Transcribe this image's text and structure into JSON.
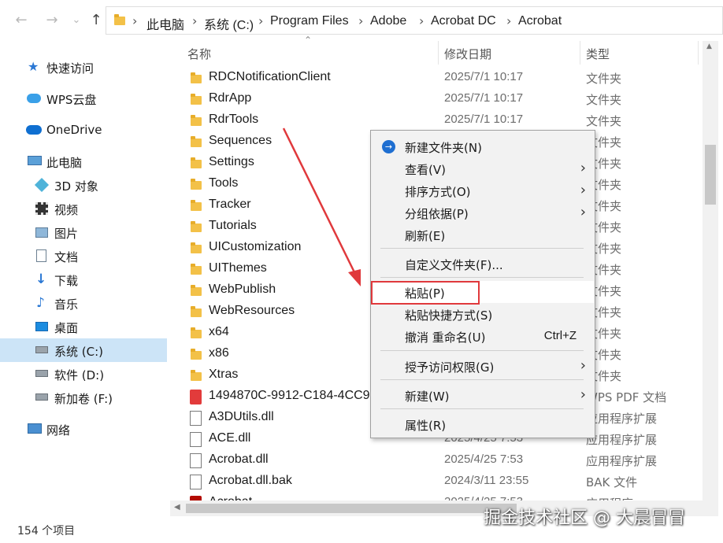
{
  "nav": {
    "back_icon": "back-arrow-icon",
    "forward_icon": "forward-arrow-icon",
    "up_icon": "up-arrow-icon",
    "breadcrumbs": [
      "此电脑",
      "系统 (C:)",
      "Program Files",
      "Adobe",
      "Acrobat DC",
      "Acrobat"
    ]
  },
  "sidebar": {
    "items": [
      {
        "label": "快速访问",
        "icon": "star-icon"
      },
      {
        "label": "WPS云盘",
        "icon": "cloud-icon"
      },
      {
        "label": "OneDrive",
        "icon": "onedrive-icon"
      },
      {
        "label": "此电脑",
        "icon": "computer-icon"
      },
      {
        "label": "3D 对象",
        "icon": "cube-icon"
      },
      {
        "label": "视频",
        "icon": "film-icon"
      },
      {
        "label": "图片",
        "icon": "picture-icon"
      },
      {
        "label": "文档",
        "icon": "document-icon"
      },
      {
        "label": "下载",
        "icon": "download-icon"
      },
      {
        "label": "音乐",
        "icon": "music-icon"
      },
      {
        "label": "桌面",
        "icon": "desktop-icon"
      },
      {
        "label": "系统 (C:)",
        "icon": "drive-icon",
        "selected": true
      },
      {
        "label": "软件 (D:)",
        "icon": "drive-icon"
      },
      {
        "label": "新加卷 (F:)",
        "icon": "drive-icon"
      },
      {
        "label": "网络",
        "icon": "network-icon"
      }
    ]
  },
  "columns": {
    "name": "名称",
    "date": "修改日期",
    "type": "类型"
  },
  "files": [
    {
      "name": "RDCNotificationClient",
      "date": "2025/7/1 10:17",
      "type": "文件夹",
      "kind": "folder"
    },
    {
      "name": "RdrApp",
      "date": "2025/7/1 10:17",
      "type": "文件夹",
      "kind": "folder"
    },
    {
      "name": "RdrTools",
      "date": "2025/7/1 10:17",
      "type": "文件夹",
      "kind": "folder"
    },
    {
      "name": "Sequences",
      "date": "",
      "type": "文件夹",
      "kind": "folder"
    },
    {
      "name": "Settings",
      "date": "",
      "type": "文件夹",
      "kind": "folder"
    },
    {
      "name": "Tools",
      "date": "",
      "type": "文件夹",
      "kind": "folder"
    },
    {
      "name": "Tracker",
      "date": "",
      "type": "文件夹",
      "kind": "folder"
    },
    {
      "name": "Tutorials",
      "date": "",
      "type": "文件夹",
      "kind": "folder"
    },
    {
      "name": "UICustomization",
      "date": "",
      "type": "文件夹",
      "kind": "folder"
    },
    {
      "name": "UIThemes",
      "date": "",
      "type": "文件夹",
      "kind": "folder"
    },
    {
      "name": "WebPublish",
      "date": "",
      "type": "文件夹",
      "kind": "folder"
    },
    {
      "name": "WebResources",
      "date": "",
      "type": "文件夹",
      "kind": "folder"
    },
    {
      "name": "x64",
      "date": "",
      "type": "文件夹",
      "kind": "folder"
    },
    {
      "name": "x86",
      "date": "",
      "type": "文件夹",
      "kind": "folder"
    },
    {
      "name": "Xtras",
      "date": "",
      "type": "文件夹",
      "kind": "folder"
    },
    {
      "name": "1494870C-9912-C184-4CC9-",
      "date": "",
      "type": "WPS PDF 文档",
      "kind": "pdf"
    },
    {
      "name": "A3DUtils.dll",
      "date": "",
      "type": "应用程序扩展",
      "kind": "dll"
    },
    {
      "name": "ACE.dll",
      "date": "2025/4/25 7:53",
      "type": "应用程序扩展",
      "kind": "dll"
    },
    {
      "name": "Acrobat.dll",
      "date": "2025/4/25 7:53",
      "type": "应用程序扩展",
      "kind": "dll"
    },
    {
      "name": "Acrobat.dll.bak",
      "date": "2024/3/11 23:55",
      "type": "BAK 文件",
      "kind": "file"
    },
    {
      "name": "Acrobat",
      "date": "2025/4/25 7:53",
      "type": "应用程序",
      "kind": "app"
    }
  ],
  "context_menu": {
    "items": [
      {
        "label": "新建文件夹(N)",
        "icon": "new-folder-icon"
      },
      {
        "label": "查看(V)",
        "submenu": true
      },
      {
        "label": "排序方式(O)",
        "submenu": true
      },
      {
        "label": "分组依据(P)",
        "submenu": true
      },
      {
        "label": "刷新(E)"
      },
      {
        "separator": true
      },
      {
        "label": "自定义文件夹(F)..."
      },
      {
        "separator": true
      },
      {
        "label": "粘贴(P)",
        "hover": true
      },
      {
        "label": "粘贴快捷方式(S)"
      },
      {
        "label": "撤消 重命名(U)",
        "shortcut": "Ctrl+Z"
      },
      {
        "separator": true
      },
      {
        "label": "授予访问权限(G)",
        "submenu": true
      },
      {
        "separator": true
      },
      {
        "label": "新建(W)",
        "submenu": true
      },
      {
        "separator": true
      },
      {
        "label": "属性(R)"
      }
    ]
  },
  "status": {
    "count": "154 个项目"
  },
  "watermark": "掘金技术社区 @ 大晨冒冒",
  "colors": {
    "highlight_box": "#e0393c",
    "arrow": "#e0393c",
    "selection": "#cce4f7"
  }
}
